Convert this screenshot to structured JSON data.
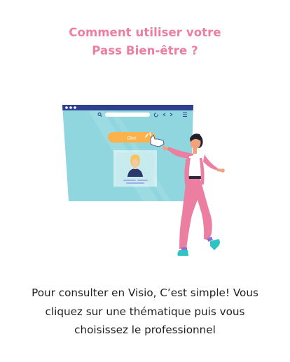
{
  "header": {
    "title_line1": "Comment utiliser votre",
    "title_line2": "Pass Bien-être ?"
  },
  "illustration": {
    "button_label": "Click",
    "icons": [
      "search-icon",
      "refresh-icon",
      "back-arrow-icon",
      "forward-arrow-icon",
      "menu-icon",
      "pointer-hand-icon"
    ]
  },
  "description": {
    "line1": "Pour consulter en Visio, C’est simple! Vous",
    "line2": "cliquez sur une thématique puis vous",
    "line3": "choisissez le professionnel"
  },
  "colors": {
    "accent_pink": "#ec7fa1",
    "browser_teal": "#8fd6de",
    "browser_bar": "#2f3f8f",
    "button_orange": "#fbb24c"
  }
}
